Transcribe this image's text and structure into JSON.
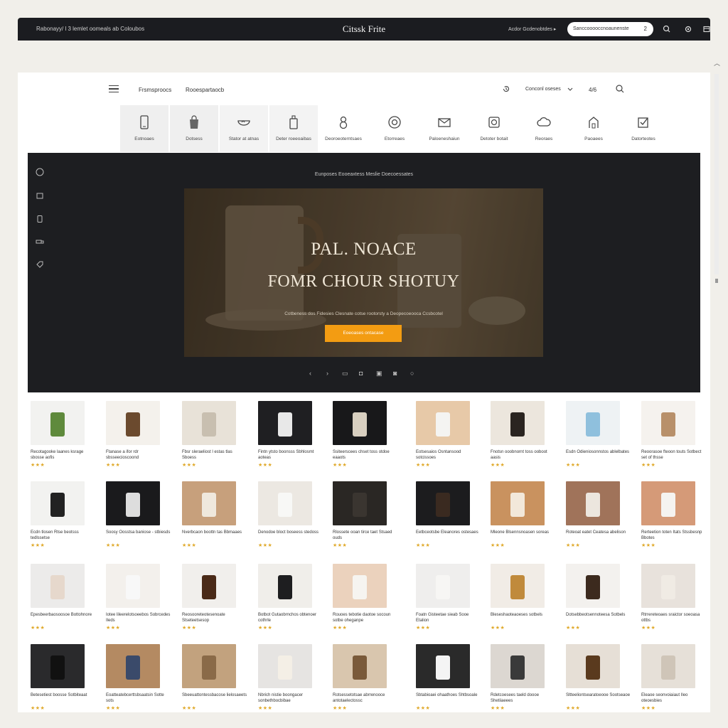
{
  "browser": {
    "left_text": "Rabonayy/ l 3 lemlet oomeals ab Coloubos",
    "brand": "Citssk Frite",
    "right_text": "Acdor Gcdenobtdes  ▸",
    "search_text": "Sanccooooccnoaunenste",
    "search_count": "2"
  },
  "nav": {
    "link1": "Frsmsproocs",
    "link2": "Rooespartaocb",
    "currency": "Conconl oseses",
    "cart": "4/6"
  },
  "categories": [
    {
      "label": "Eotnoaes",
      "icon": "phone-icon"
    },
    {
      "label": "Dotsess",
      "icon": "bag-icon"
    },
    {
      "label": "Stator at atnas",
      "icon": "bowl-icon"
    },
    {
      "label": "Deter roeeoaibas",
      "icon": "bottle-icon"
    },
    {
      "label": "Deoroeoterntsaes",
      "icon": "figure-icon"
    },
    {
      "label": "Etorreaes",
      "icon": "target-icon"
    },
    {
      "label": "Paloeneshaiun",
      "icon": "envelope-icon"
    },
    {
      "label": "Detoter botait",
      "icon": "camera-icon"
    },
    {
      "label": "Reoraes",
      "icon": "cloud-icon"
    },
    {
      "label": "Paoaees",
      "icon": "house-icon"
    },
    {
      "label": "Datorteotes",
      "icon": "checkbox-icon"
    }
  ],
  "hero": {
    "crumb": "Eunposes Eooeaxtess   Meslie Doecoessates",
    "title_line1": "PAL. NOACE",
    "title_line2": "FOMR CHOUR SHOTUY",
    "subtitle": "Cotbeness dos Fidesies Clesnate cotse rootorsty a Deopecoeooca Ccsbcotel",
    "cta": "Eoeoases ontacase"
  },
  "products": [
    {
      "title": "Recotagooke laanes ksrage sbosse aofis",
      "stars": "★★★"
    },
    {
      "title": "Ftanase a ifor rdr sbsseecioscoond",
      "stars": "★★★"
    },
    {
      "title": "Fbsr sleraeliost l estas tlas Sboess",
      "stars": "★★★"
    },
    {
      "title": "Fintn ytsto boonsss Sbhlosmt aoteas",
      "stars": "★★★"
    },
    {
      "title": "Ssiteerscees chset toss otdoe eaaots",
      "stars": "★★★"
    },
    {
      "title": "Eotsesaios Osntansood sotcissoes",
      "stars": "★★★"
    },
    {
      "title": "Fnotsn ooobnornt toss ooboot aasis",
      "stars": "★★★"
    },
    {
      "title": "Esdn Odieniosonnstos ablelbates",
      "stars": "★★★"
    },
    {
      "title": "Reoorasoe fteoon touts Sotbect set of thsse",
      "stars": "★★★"
    },
    {
      "title": "Ecdn tlosen Rtse beotsss tedlssetse",
      "stars": "★★★"
    },
    {
      "title": "Soosy Oosstsa baniose - stbiesds",
      "stars": "★★★"
    },
    {
      "title": "Nverbcaon boottn  tas Bbmaaes",
      "stars": "★★★"
    },
    {
      "title": "Denodoe bloct boseess stedoss",
      "stars": "★★★"
    },
    {
      "title": "Rlossete ooan tirce taet Stsaed ouds",
      "stars": "★★★"
    },
    {
      "title": "Eetbceotsbe Eleanores ostesaes",
      "stars": "★★★"
    },
    {
      "title": "Mleone Blsennsnoasen soreas",
      "stars": "★★★"
    },
    {
      "title": "Roteoat eatet Ceatesa abelison",
      "stars": "★★★"
    },
    {
      "title": "Rerteetion toten Itats Stssbesnp Bbotes",
      "stars": "★★★"
    },
    {
      "title": "Epesbeerbaosoosoe Bottohnore",
      "stars": "★★★"
    },
    {
      "title": "Iotee lileerelotsoeebos Sobrcedes Ileds",
      "stars": "★★★"
    },
    {
      "title": "Reosooreteotesenoate Stseteetsesop",
      "stars": "★★★"
    },
    {
      "title": "Botbot Gutaobrnchos obtenoer cothrle",
      "stars": "★★★"
    },
    {
      "title": "Rouoes tebotie daotoe socoun sotbe oheganpe",
      "stars": "★★★"
    },
    {
      "title": "Foatn Gisteetae sieab Sooe Etalion",
      "stars": "★★★"
    },
    {
      "title": "Bleseshaoteaoeses sotbels",
      "stars": "★★★"
    },
    {
      "title": "Dotsebbeotsennoteesa Sotbels",
      "stars": "★★★"
    },
    {
      "title": "Rtrrereteoaes  sraictor soeoasa ottbs",
      "stars": "★★★"
    },
    {
      "title": "Betesetiest boosse Sotbiteaat",
      "stars": "★★★"
    },
    {
      "title": "Eoatteatebcerttsbsaatsin Sotte sots",
      "stars": "★★★"
    },
    {
      "title": "Sbeeuattontessbacose lielosaeets",
      "stars": "★★★"
    },
    {
      "title": "Nbrich nistie boongacer sonbethbocbibae",
      "stars": "★★★"
    },
    {
      "title": "Rotsessetotsae abrrenooce antotaelectossc",
      "stars": "★★★"
    },
    {
      "title": "Sbtabioaei ohaathoes Shtbsoale",
      "stars": "★★★"
    },
    {
      "title": "Rdetcoesees taeld doooe Shetiiaeees",
      "stars": "★★★"
    },
    {
      "title": "Sltteeliontsearatoeooe Sootseaoe",
      "stars": "★★★"
    },
    {
      "title": "Eleaoe seonvoiaiaut Ileo oteoesbies",
      "stars": "★★★"
    }
  ],
  "colors": {
    "accent": "#f39c12",
    "dark": "#1d1e21",
    "star": "#e0a92a"
  }
}
